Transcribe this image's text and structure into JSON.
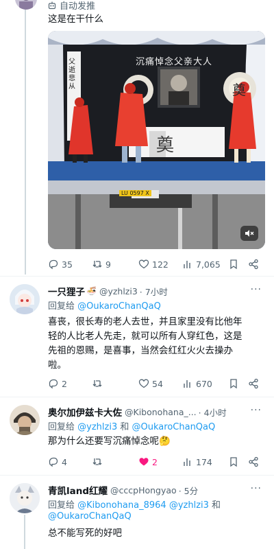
{
  "top": {
    "auto_translate_label": "自动发推",
    "post_text": "这是在干什么"
  },
  "video": {
    "banner_text": "沉痛悼念父亲大人",
    "side_scroll_text": "父逝悲从",
    "wreath_char_1": "奠",
    "wreath_char_2": "奠",
    "plate_text": "LU 0597 X"
  },
  "post_stats": {
    "replies": "35",
    "retweets": "9",
    "likes": "122",
    "views": "7,065"
  },
  "replies": [
    {
      "name": "一只狸子",
      "emoji": "🍜",
      "handle": "@yzhlzi3",
      "time": "· 7小时",
      "reply_to_prefix": "回复给",
      "reply_to": "@OukaroChanQaQ",
      "text_lines": [
        "喜丧，很长寿的老人去世，并且家里没有比他年",
        "轻的人比老人先走，就可以所有人穿红色，这是",
        "先祖的恩赐，是喜事，当然会红红火火去操办",
        "啦。"
      ],
      "stats": {
        "replies": "2",
        "retweets": "",
        "likes": "54",
        "views": "670"
      },
      "liked": false
    },
    {
      "name": "奥尔加伊兹卡大佐",
      "handle": "@Kibonohana_...",
      "time": "· 4小时",
      "reply_to_prefix": "回复给",
      "reply_to": "@yzhlzi3",
      "reply_to_and": "和",
      "reply_to_2": "@OukaroChanQaQ",
      "text": "那为什么还要写沉痛悼念呢",
      "text_emoji": "🤔",
      "stats": {
        "replies": "4",
        "retweets": "",
        "likes": "2",
        "views": "174"
      },
      "liked": true
    },
    {
      "name": "青凯land红耀",
      "handle": "@cccpHongyao",
      "time": "· 5分",
      "reply_to_prefix": "回复给",
      "reply_to": "@Kibonohana_8964",
      "reply_to_2": "@yzhlzi3",
      "reply_to_and": "和",
      "reply_to_3": "@OukaroChanQaQ",
      "text": "总不能写死的好吧"
    }
  ],
  "colors": {
    "accent": "#1d9bf0",
    "like_active": "#f91880",
    "muted": "#536471"
  }
}
